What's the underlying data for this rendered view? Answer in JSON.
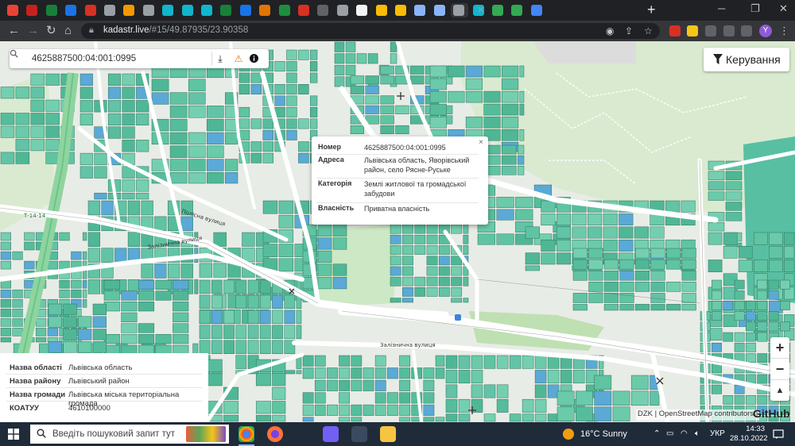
{
  "browser": {
    "url_host": "kadastr.live",
    "url_path": "/#15/49.87935/23.90358",
    "profile_initial": "Y",
    "tabs": [
      {
        "color": "#ea4335"
      },
      {
        "color": "#c5221f"
      },
      {
        "color": "#188038"
      },
      {
        "color": "#1a73e8"
      },
      {
        "color": "#d93025"
      },
      {
        "color": "#9aa0a6"
      },
      {
        "color": "#f29900"
      },
      {
        "color": "#9aa0a6"
      },
      {
        "color": "#12b5cb"
      },
      {
        "color": "#12b5cb"
      },
      {
        "color": "#12b5cb"
      },
      {
        "color": "#188038"
      },
      {
        "color": "#1a73e8"
      },
      {
        "color": "#e37400"
      },
      {
        "color": "#1e8e3e"
      },
      {
        "color": "#d93025"
      },
      {
        "color": "#5f6368"
      },
      {
        "color": "#9aa0a6"
      },
      {
        "color": "#f1f3f4"
      },
      {
        "color": "#fbbc04"
      },
      {
        "color": "#fbbc04"
      },
      {
        "color": "#8ab4f8"
      },
      {
        "color": "#8ab4f8"
      },
      {
        "color": "#9aa0a6"
      },
      {
        "color": "#12b5cb"
      },
      {
        "color": "#34a853"
      },
      {
        "color": "#34a853"
      },
      {
        "color": "#4285f4"
      }
    ]
  },
  "map": {
    "search": {
      "value": "4625887500:04:001:0995"
    },
    "control_label": "Керування",
    "popup": {
      "rows": [
        {
          "key": "Номер",
          "value": "4625887500:04:001:0995"
        },
        {
          "key": "Адреса",
          "value": "Львівська область, Яворівський район, село Рясне-Руське"
        },
        {
          "key": "Категорія",
          "value": "Землі житлової та громадської забудови"
        },
        {
          "key": "Власність",
          "value": "Приватна власність"
        }
      ]
    },
    "info": {
      "rows": [
        {
          "key": "Назва області",
          "value": "Львівська область"
        },
        {
          "key": "Назва району",
          "value": "Львівський район"
        },
        {
          "key": "Назва громади",
          "value": "Львівська міська територіальна громада"
        },
        {
          "key": "КОАТУУ",
          "value": "4610100000"
        }
      ]
    },
    "street_labels": [
      {
        "text": "Полісна вулиця"
      },
      {
        "text": "Залізнична вулиця"
      },
      {
        "text": "Залізнична вулиця"
      },
      {
        "text": "Т-14-14"
      }
    ],
    "attribution": "DZK | OpenStreetMap contributors |",
    "github": "GitHub"
  },
  "taskbar": {
    "search_placeholder": "Введіть пошуковий запит тут",
    "weather": "16°C  Sunny",
    "lang": "УКР",
    "time": "14:33",
    "date": "28.10.2022"
  }
}
